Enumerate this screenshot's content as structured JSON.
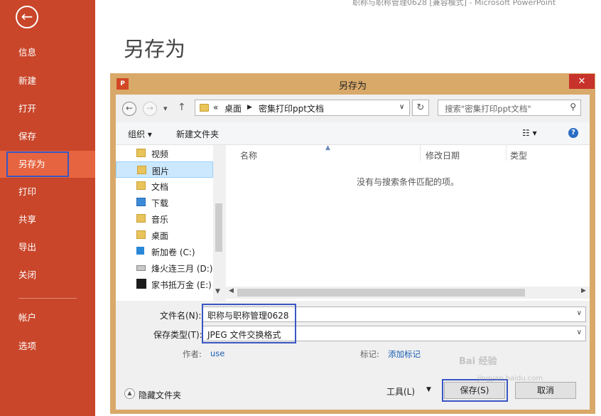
{
  "window": {
    "title": "职称与职称管理0628 [兼容模式] - Microsoft PowerPoint"
  },
  "backstage": {
    "back_icon": "back-arrow-icon",
    "nav": [
      "信息",
      "新建",
      "打开",
      "保存",
      "另存为",
      "打印",
      "共享",
      "导出",
      "关闭"
    ],
    "nav_bottom": [
      "帐户",
      "选项"
    ],
    "active": "另存为",
    "heading": "另存为"
  },
  "dialog": {
    "title": "另存为",
    "app_icon_text": "P",
    "close_symbol": "✕",
    "address": {
      "prefix": "«",
      "crumbs": [
        "桌面",
        "密集打印ppt文档"
      ]
    },
    "search_placeholder": "搜索\"密集打印ppt文档\"",
    "toolbar": {
      "organize": "组织 ▾",
      "new_folder": "新建文件夹"
    },
    "nav_tree": [
      {
        "label": "视频",
        "icon": "video-folder-icon"
      },
      {
        "label": "图片",
        "icon": "pictures-folder-icon",
        "selected": true
      },
      {
        "label": "文档",
        "icon": "documents-folder-icon"
      },
      {
        "label": "下载",
        "icon": "downloads-folder-icon"
      },
      {
        "label": "音乐",
        "icon": "music-folder-icon"
      },
      {
        "label": "桌面",
        "icon": "desktop-folder-icon"
      },
      {
        "label": "新加卷 (C:)",
        "icon": "windows-drive-icon"
      },
      {
        "label": "烽火连三月 (D:)",
        "icon": "drive-icon"
      },
      {
        "label": "家书抵万金 (E:)",
        "icon": "drive-app-icon"
      }
    ],
    "columns": [
      "名称",
      "修改日期",
      "类型"
    ],
    "empty_message": "没有与搜索条件匹配的项。",
    "filename_label": "文件名(N):",
    "filename_value": "职称与职称管理0628",
    "filetype_label": "保存类型(T):",
    "filetype_value": "JPEG 文件交换格式",
    "author_label": "作者:",
    "author_value": "use",
    "tags_label": "标记:",
    "tags_value": "添加标记",
    "hide_folders": "隐藏文件夹",
    "tools_label": "工具(L)",
    "save_label": "保存(S)",
    "cancel_label": "取消"
  },
  "watermark": {
    "text": "Bai 经验",
    "url": "jingyan.baidu.com"
  }
}
